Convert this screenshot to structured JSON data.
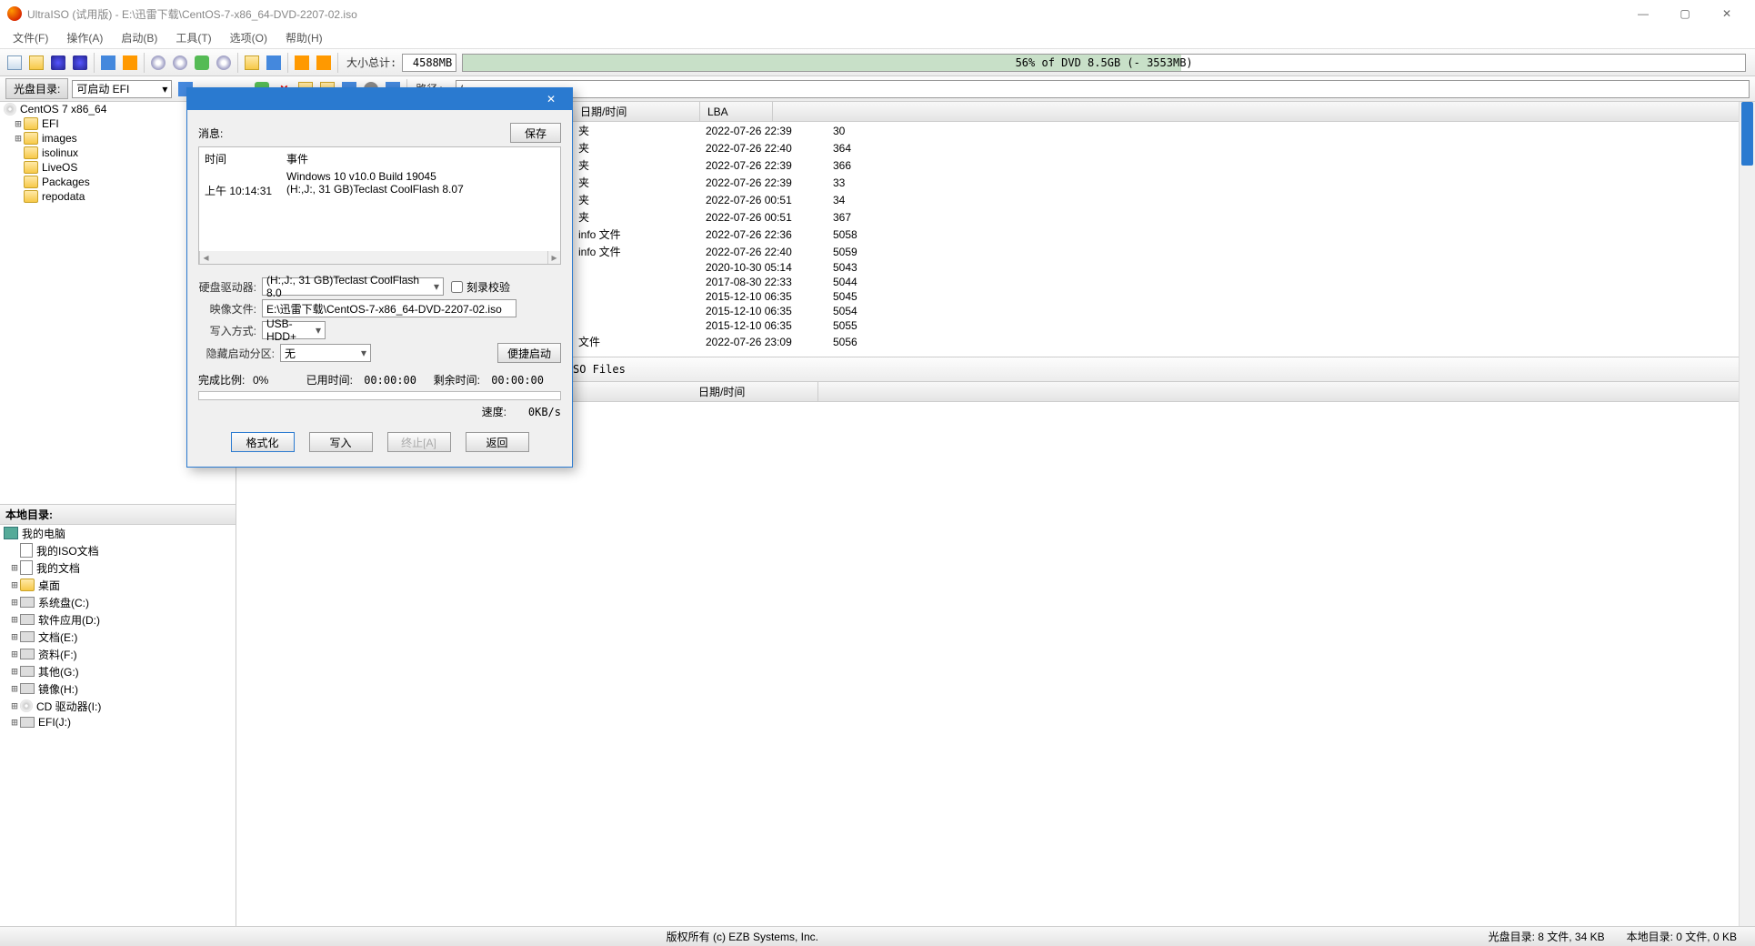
{
  "titlebar": {
    "text": "UltraISO (试用版) - E:\\迅雷下载\\CentOS-7-x86_64-DVD-2207-02.iso"
  },
  "menu": {
    "file": "文件(F)",
    "action": "操作(A)",
    "boot": "启动(B)",
    "tools": "工具(T)",
    "options": "选项(O)",
    "help": "帮助(H)"
  },
  "toolbar": {
    "size_label": "大小总计:",
    "size_value": "4588MB",
    "progress_text": "56% of DVD 8.5GB (- 3553MB)"
  },
  "toolbar2": {
    "area1_label": "光盘目录:",
    "combo_value": "可启动 EFI",
    "path_label": "路径:",
    "path_value": "/"
  },
  "iso_tree": {
    "root": "CentOS 7 x86_64",
    "items": [
      "EFI",
      "images",
      "isolinux",
      "LiveOS",
      "Packages",
      "repodata"
    ]
  },
  "list_header": {
    "col_date": "日期/时间",
    "col_lba": "LBA"
  },
  "list_rows": [
    {
      "type": "夹",
      "date": "2022-07-26 22:39",
      "lba": "30"
    },
    {
      "type": "夹",
      "date": "2022-07-26 22:40",
      "lba": "364"
    },
    {
      "type": "夹",
      "date": "2022-07-26 22:39",
      "lba": "366"
    },
    {
      "type": "夹",
      "date": "2022-07-26 22:39",
      "lba": "33"
    },
    {
      "type": "夹",
      "date": "2022-07-26 00:51",
      "lba": "34"
    },
    {
      "type": "夹",
      "date": "2022-07-26 00:51",
      "lba": "367"
    },
    {
      "type": "info 文件",
      "date": "2022-07-26 22:36",
      "lba": "5058"
    },
    {
      "type": "info 文件",
      "date": "2022-07-26 22:40",
      "lba": "5059"
    },
    {
      "type": "",
      "date": "2020-10-30 05:14",
      "lba": "5043"
    },
    {
      "type": "",
      "date": "2017-08-30 22:33",
      "lba": "5044"
    },
    {
      "type": "",
      "date": "2015-12-10 06:35",
      "lba": "5045"
    },
    {
      "type": "",
      "date": "2015-12-10 06:35",
      "lba": "5054"
    },
    {
      "type": "",
      "date": "2015-12-10 06:35",
      "lba": "5055"
    },
    {
      "type": "文件",
      "date": "2022-07-26 23:09",
      "lba": "5056"
    }
  ],
  "local": {
    "header": "本地目录:",
    "root": "我的电脑",
    "iso_docs": "我的ISO文档",
    "my_docs": "我的文档",
    "desktop": "桌面",
    "drives": [
      "系统盘(C:)",
      "软件应用(D:)",
      "文档(E:)",
      "资料(F:)",
      "其他(G:)",
      "镜像(H:)",
      "CD 驱动器(I:)",
      "EFI(J:)"
    ]
  },
  "local_list": {
    "header_path": "SO Files",
    "col_date": "日期/时间"
  },
  "statusbar": {
    "copyright": "版权所有 (c) EZB Systems, Inc.",
    "disc_stats": "光盘目录: 8 文件, 34 KB",
    "local_stats": "本地目录: 0 文件, 0 KB"
  },
  "dialog": {
    "msg_label": "消息:",
    "save_btn": "保存",
    "msg_header_time": "时间",
    "msg_header_event": "事件",
    "msg_rows": [
      {
        "time": "",
        "event": "Windows 10 v10.0 Build 19045"
      },
      {
        "time": "上午 10:14:31",
        "event": "(H:,J:, 31 GB)Teclast CoolFlash     8.07"
      }
    ],
    "disk_label": "硬盘驱动器:",
    "disk_value": "(H:,J:, 31 GB)Teclast CoolFlash      8.0",
    "verify_label": "刻录校验",
    "image_label": "映像文件:",
    "image_value": "E:\\迅雷下载\\CentOS-7-x86_64-DVD-2207-02.iso",
    "method_label": "写入方式:",
    "method_value": "USB-HDD+",
    "hide_label": "隐藏启动分区:",
    "hide_value": "无",
    "quick_boot": "便捷启动",
    "done_pct_label": "完成比例:",
    "done_pct": "0%",
    "elapsed_label": "已用时间:",
    "elapsed": "00:00:00",
    "remain_label": "剩余时间:",
    "remain": "00:00:00",
    "speed_label": "速度:",
    "speed": "0KB/s",
    "btn_format": "格式化",
    "btn_write": "写入",
    "btn_abort": "终止[A]",
    "btn_return": "返回"
  }
}
